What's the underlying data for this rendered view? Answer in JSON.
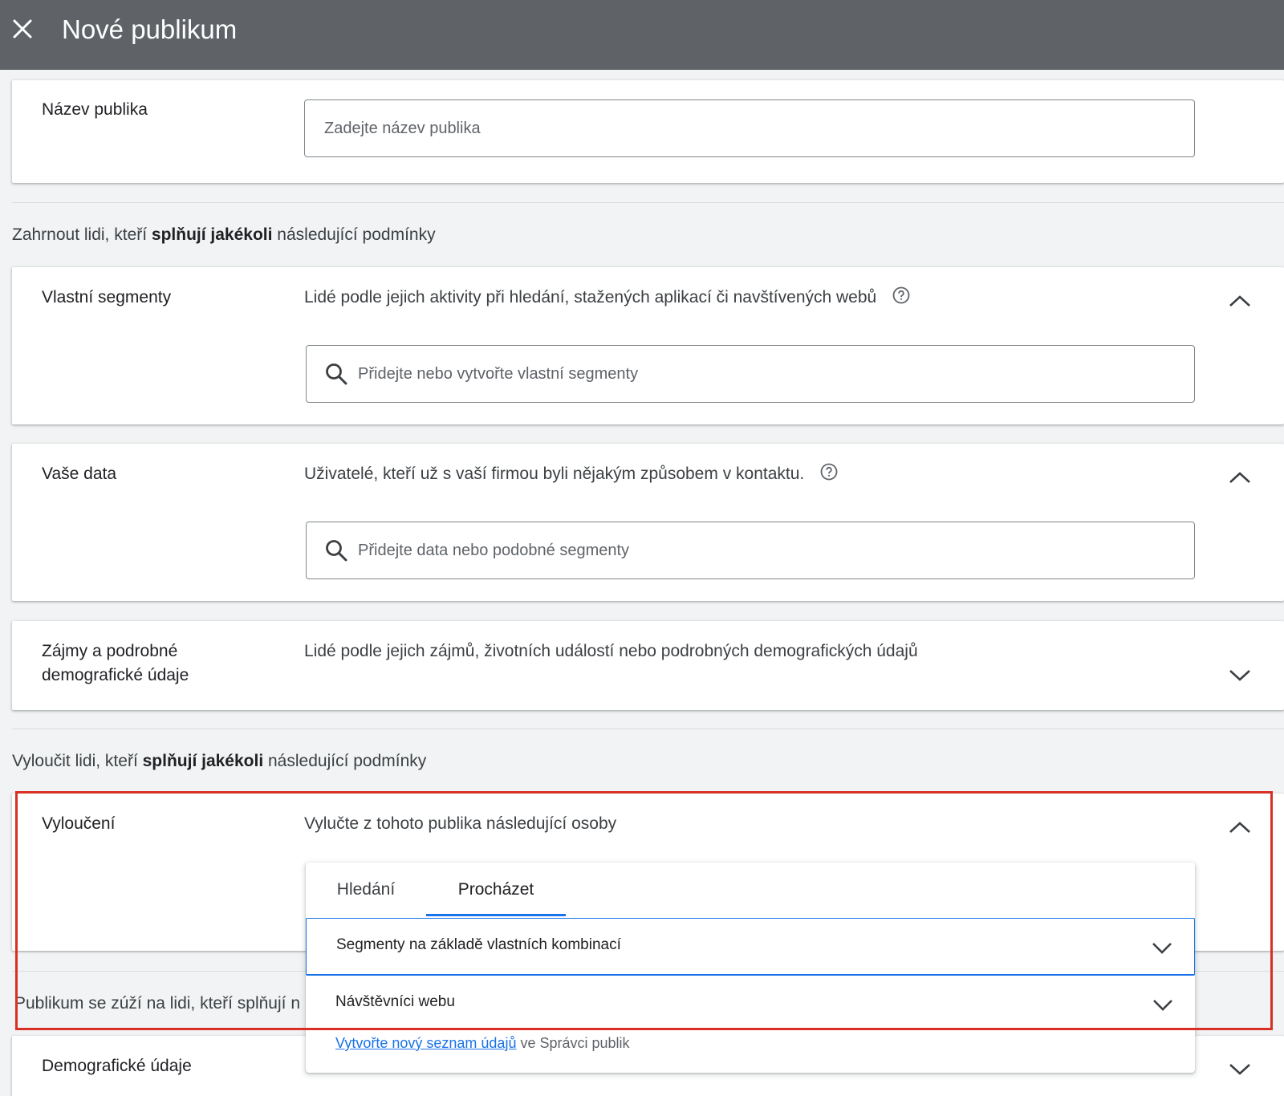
{
  "header": {
    "title": "Nové publikum",
    "close_icon": "close-icon"
  },
  "audience_name": {
    "label": "Název publika",
    "placeholder": "Zadejte název publika"
  },
  "include_section": {
    "prefix": "Zahrnout lidi, kteří ",
    "bold": "splňují jakékoli",
    "suffix": " následující podmínky"
  },
  "custom_segments": {
    "label": "Vlastní segmenty",
    "description": "Lidé podle jejich aktivity při hledání, stažených aplikací či navštívených webů",
    "placeholder": "Přidejte nebo vytvořte vlastní segmenty"
  },
  "your_data": {
    "label": "Vaše data",
    "description": "Uživatelé, kteří už s vaší firmou byli nějakým způsobem v kontaktu.",
    "placeholder": "Přidejte data nebo podobné segmenty"
  },
  "interests": {
    "label_line1": "Zájmy a podrobné",
    "label_line2": "demografické údaje",
    "description": "Lidé podle jejich zájmů, životních událostí nebo podrobných demografických údajů"
  },
  "exclude_section": {
    "prefix": "Vyloučit lidi, kteří ",
    "bold": "splňují jakékoli",
    "suffix": " následující podmínky"
  },
  "exclusions": {
    "label": "Vyloučení",
    "description": "Vylučte z tohoto publika následující osoby",
    "tabs": [
      {
        "label": "Hledání",
        "active": false
      },
      {
        "label": "Procházet",
        "active": true
      }
    ],
    "dropdowns": [
      {
        "label": "Segmenty na základě vlastních kombinací",
        "selected": true
      },
      {
        "label": "Návštěvníci webu",
        "selected": false
      }
    ],
    "footer_link": "Vytvořte nový seznam údajů",
    "footer_text": " ve Správci publik"
  },
  "narrow_section": {
    "text": "Publikum se zúží na lidi, kteří splňují n"
  },
  "demographics": {
    "label": "Demografické údaje"
  },
  "colors": {
    "accent": "#1a73e8",
    "highlight": "#d93025",
    "topbar": "#5f6368"
  }
}
